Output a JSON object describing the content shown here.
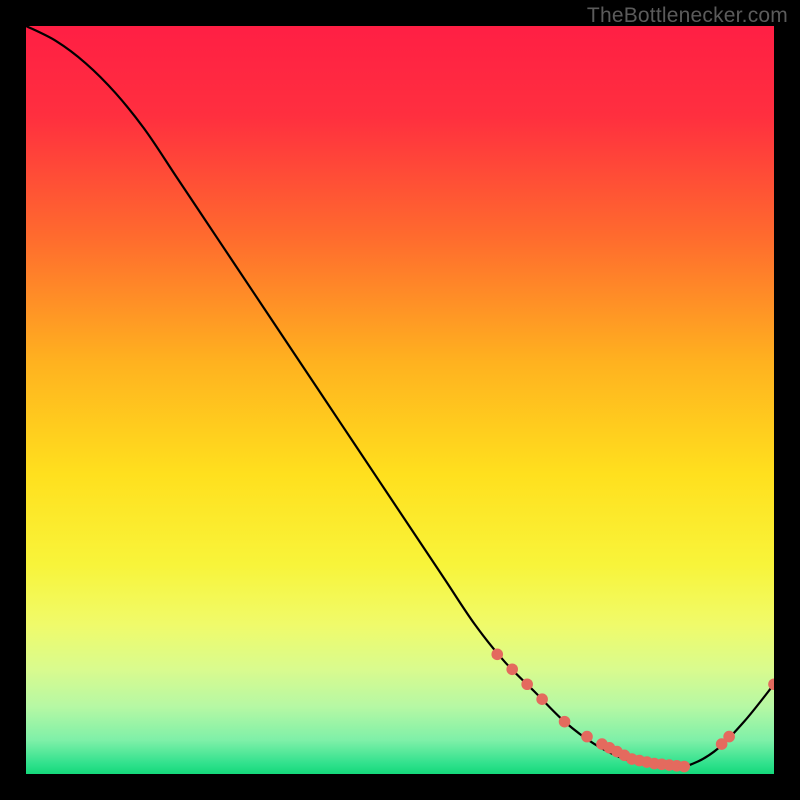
{
  "watermark": "TheBottlenecker.com",
  "chart_data": {
    "type": "line",
    "title": "",
    "xlabel": "",
    "ylabel": "",
    "xlim": [
      0,
      100
    ],
    "ylim": [
      0,
      100
    ],
    "series": [
      {
        "name": "curve",
        "x": [
          0,
          4,
          8,
          12,
          16,
          20,
          24,
          28,
          32,
          36,
          40,
          44,
          48,
          52,
          56,
          60,
          64,
          68,
          72,
          76,
          80,
          84,
          88,
          92,
          96,
          100
        ],
        "values": [
          100,
          98,
          95,
          91,
          86,
          80,
          74,
          68,
          62,
          56,
          50,
          44,
          38,
          32,
          26,
          20,
          15,
          11,
          7,
          4,
          2,
          1,
          1,
          3,
          7,
          12
        ]
      }
    ],
    "marker_points": {
      "x": [
        63,
        65,
        67,
        69,
        72,
        75,
        77,
        78,
        79,
        80,
        81,
        82,
        83,
        84,
        85,
        86,
        87,
        88,
        93,
        94,
        100
      ],
      "values": [
        16,
        14,
        12,
        10,
        7,
        5,
        4,
        3.5,
        3,
        2.5,
        2,
        1.8,
        1.6,
        1.4,
        1.3,
        1.2,
        1.1,
        1,
        4,
        5,
        12
      ]
    },
    "gradient_stops": [
      {
        "offset": 0.0,
        "color": "#ff1f44"
      },
      {
        "offset": 0.12,
        "color": "#ff2f3f"
      },
      {
        "offset": 0.28,
        "color": "#ff6a2e"
      },
      {
        "offset": 0.45,
        "color": "#ffb21f"
      },
      {
        "offset": 0.6,
        "color": "#ffe01e"
      },
      {
        "offset": 0.72,
        "color": "#f8f43a"
      },
      {
        "offset": 0.8,
        "color": "#f0fb6a"
      },
      {
        "offset": 0.86,
        "color": "#d9fb8e"
      },
      {
        "offset": 0.91,
        "color": "#b6f8a4"
      },
      {
        "offset": 0.955,
        "color": "#7ef0a8"
      },
      {
        "offset": 0.985,
        "color": "#33e28e"
      },
      {
        "offset": 1.0,
        "color": "#14d97b"
      }
    ],
    "marker_color": "#e46a5e",
    "line_color": "#000000"
  }
}
